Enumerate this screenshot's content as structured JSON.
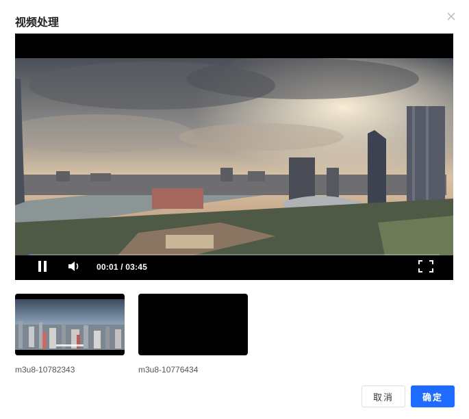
{
  "dialog": {
    "title": "视频处理",
    "close_icon": "close-icon"
  },
  "player": {
    "current_time": "00:01",
    "duration": "03:45",
    "time_display": "00:01 / 03:45",
    "progress_fraction": 0.005,
    "state": "playing",
    "icons": {
      "pause": "pause-icon",
      "volume": "volume-icon",
      "fullscreen": "fullscreen-icon"
    },
    "colors": {
      "progress": "#2f7dff",
      "background": "#000000"
    }
  },
  "videos": [
    {
      "name": "m3u8-10782343",
      "has_preview": true
    },
    {
      "name": "m3u8-10776434",
      "has_preview": false
    }
  ],
  "actions": {
    "cancel_label": "取消",
    "confirm_label": "确定"
  },
  "colors": {
    "primary": "#1f6bff"
  }
}
